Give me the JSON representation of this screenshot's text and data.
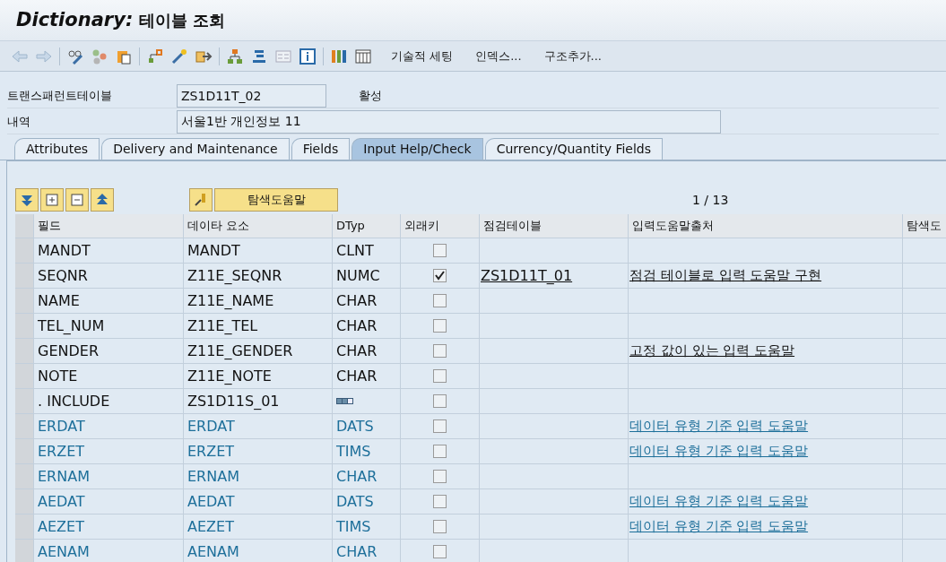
{
  "window": {
    "title_bold": "Dictionary:",
    "title": "테이블 조회"
  },
  "toolbar": {
    "text_buttons": [
      "기술적 세팅",
      "인덱스...",
      "구조추가..."
    ]
  },
  "header_fields": [
    {
      "label": "트랜스패런트테이블",
      "value": "ZS1D11T_02",
      "status": "활성"
    },
    {
      "label": "내역",
      "value": "서울1반 개인정보 11"
    }
  ],
  "tabs": [
    {
      "label": "Attributes",
      "selected": false
    },
    {
      "label": "Delivery and Maintenance",
      "selected": false
    },
    {
      "label": "Fields",
      "selected": false
    },
    {
      "label": "Input Help/Check",
      "selected": true
    },
    {
      "label": "Currency/Quantity Fields",
      "selected": false
    }
  ],
  "search_help_button": "탐색도움말",
  "page_indicator": "1 / 13",
  "table": {
    "columns": [
      "필드",
      "데이타 요소",
      "DTyp",
      "외래키",
      "점검테이블",
      "입력도움말출처",
      "탐색도"
    ],
    "rows": [
      {
        "kind": "field",
        "field": "MANDT",
        "data_element": "MANDT",
        "dtyp": "CLNT",
        "foreign_key": false
      },
      {
        "kind": "field",
        "field": "SEQNR",
        "data_element": "Z11E_SEQNR",
        "dtyp": "NUMC",
        "foreign_key": true,
        "check_table": "ZS1D11T_01",
        "help_source": "점검 테이블로 입력 도움말 구현"
      },
      {
        "kind": "field",
        "field": "NAME",
        "data_element": "Z11E_NAME",
        "dtyp": "CHAR",
        "foreign_key": false
      },
      {
        "kind": "field",
        "field": "TEL_NUM",
        "data_element": "Z11E_TEL",
        "dtyp": "CHAR",
        "foreign_key": false
      },
      {
        "kind": "field",
        "field": "GENDER",
        "data_element": "Z11E_GENDER",
        "dtyp": "CHAR",
        "foreign_key": false,
        "help_source": "고정 값이 있는 입력 도움말"
      },
      {
        "kind": "field",
        "field": "NOTE",
        "data_element": "Z11E_NOTE",
        "dtyp": "CHAR",
        "foreign_key": false
      },
      {
        "kind": "include",
        "field": ". INCLUDE",
        "data_element": "ZS1D11S_01",
        "foreign_key": false
      },
      {
        "kind": "included",
        "field": "ERDAT",
        "data_element": "ERDAT",
        "dtyp": "DATS",
        "foreign_key": false,
        "help_source": "데이터 유형 기준 입력 도움말"
      },
      {
        "kind": "included",
        "field": "ERZET",
        "data_element": "ERZET",
        "dtyp": "TIMS",
        "foreign_key": false,
        "help_source": "데이터 유형 기준 입력 도움말"
      },
      {
        "kind": "included",
        "field": "ERNAM",
        "data_element": "ERNAM",
        "dtyp": "CHAR",
        "foreign_key": false
      },
      {
        "kind": "included",
        "field": "AEDAT",
        "data_element": "AEDAT",
        "dtyp": "DATS",
        "foreign_key": false,
        "help_source": "데이터 유형 기준 입력 도움말"
      },
      {
        "kind": "included",
        "field": "AEZET",
        "data_element": "AEZET",
        "dtyp": "TIMS",
        "foreign_key": false,
        "help_source": "데이터 유형 기준 입력 도움말"
      },
      {
        "kind": "included",
        "field": "AENAM",
        "data_element": "AENAM",
        "dtyp": "CHAR",
        "foreign_key": false
      }
    ]
  }
}
